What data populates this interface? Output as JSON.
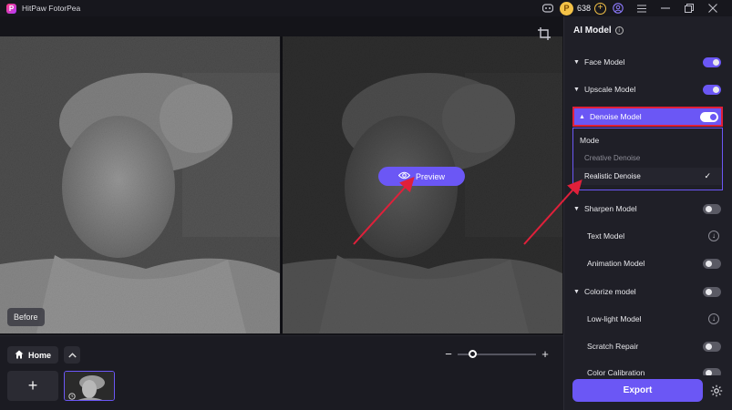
{
  "app": {
    "title": "HitPaw FotorPea",
    "logo_letter": "P"
  },
  "titlebar": {
    "coin_symbol": "P",
    "coin_count": "638",
    "icons": [
      "discord-icon",
      "coin-icon",
      "add-credits-icon",
      "user-icon",
      "menu-icon",
      "minimize-icon",
      "restore-icon",
      "close-icon"
    ]
  },
  "canvas": {
    "before_label": "Before",
    "preview_label": "Preview"
  },
  "bottom": {
    "home_label": "Home",
    "add_symbol": "+"
  },
  "zoom": {
    "minus": "−",
    "plus": "+",
    "level": 0.14
  },
  "sidebar": {
    "title": "AI Model",
    "models": [
      {
        "label": "Face Model",
        "state": "on"
      },
      {
        "label": "Upscale Model",
        "state": "on"
      },
      {
        "label": "Denoise Model",
        "state": "on"
      },
      {
        "label": "Sharpen Model",
        "state": "off"
      },
      {
        "label": "Text Model",
        "state": "download"
      },
      {
        "label": "Animation Model",
        "state": "off"
      },
      {
        "label": "Colorize model",
        "state": "off"
      },
      {
        "label": "Low-light Model",
        "state": "download"
      },
      {
        "label": "Scratch Repair",
        "state": "off"
      },
      {
        "label": "Color Calibration",
        "state": "off"
      }
    ],
    "mode": {
      "heading": "Mode",
      "options": [
        "Creative Denoise",
        "Realistic Denoise"
      ],
      "selected": "Realistic Denoise"
    }
  },
  "footer": {
    "export_label": "Export"
  },
  "colors": {
    "accent": "#6b57f5",
    "highlight": "#e0203a",
    "bg": "#1b1b22"
  }
}
